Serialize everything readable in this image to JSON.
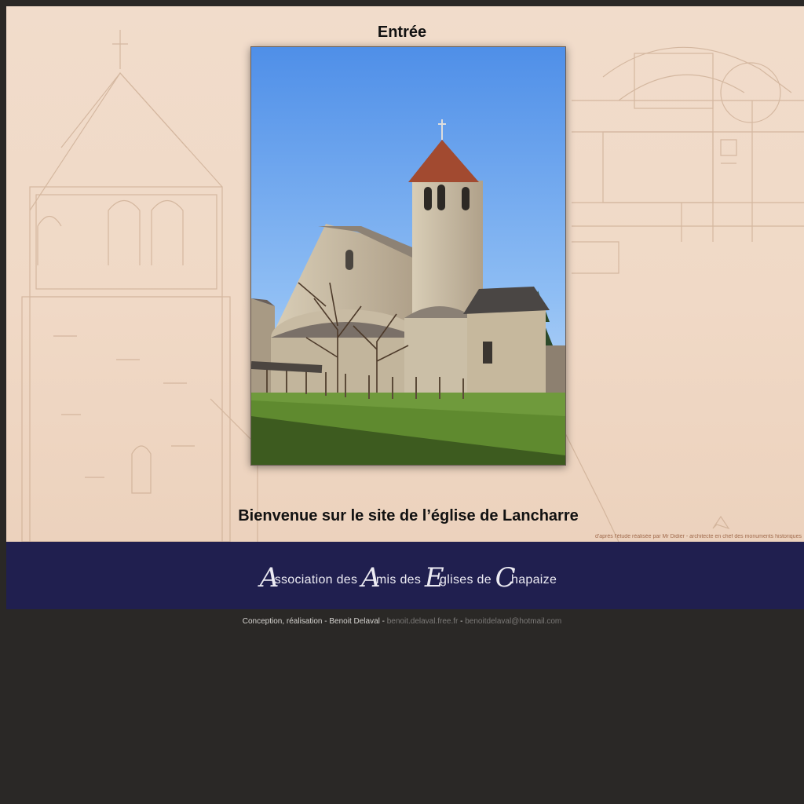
{
  "page": {
    "title": "Entrée",
    "welcome": "Bienvenue sur le site de l’église de Lancharre",
    "background_note": "d'après l'étude réalisée par Mr Didier - architecte en chef des monuments historiques"
  },
  "photo": {
    "icon": "church-photo"
  },
  "banner": {
    "words": [
      {
        "cap": "A",
        "rest": "ssociation"
      },
      {
        "cap": "",
        "rest": "des"
      },
      {
        "cap": "A",
        "rest": "mis"
      },
      {
        "cap": "",
        "rest": "des"
      },
      {
        "cap": "E",
        "rest": "glises"
      },
      {
        "cap": "",
        "rest": "de"
      },
      {
        "cap": "C",
        "rest": "hapaize"
      }
    ]
  },
  "footer": {
    "credit": "Conception, réalisation - Benoit Delaval - ",
    "site_link": "benoit.delaval.free.fr",
    "separator": " - ",
    "email_link": "benoitdelaval@hotmail.com"
  },
  "colors": {
    "banner": "#201f4f",
    "page_bg": "#2a2826",
    "parchment": "#f0d9c6"
  }
}
